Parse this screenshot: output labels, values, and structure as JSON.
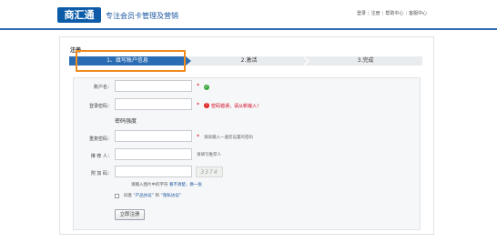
{
  "header": {
    "logo_text": "商汇通",
    "slogan": "专注会员卡管理及营销",
    "links": [
      "登录",
      "注册",
      "帮助中心",
      "客服中心"
    ]
  },
  "panel": {
    "title": "注册",
    "steps": [
      "1、填写账户信息",
      "2.激活",
      "3.完成"
    ]
  },
  "form": {
    "username": {
      "label": "账户名：",
      "value": ""
    },
    "password": {
      "label": "登录密码：",
      "value": "",
      "error": "密码错误，请从新输入！"
    },
    "strength_label": "密码强度",
    "confirm": {
      "label": "重复密码：",
      "value": "",
      "hint": "请再输入一遍您设置的密码"
    },
    "referrer": {
      "label": "推 荐 人：",
      "value": "",
      "hint": "请填写推荐人"
    },
    "captcha": {
      "label": "附 加 码：",
      "value": "",
      "image_text": "3374",
      "hint_prefix": "请输入图片中的字符",
      "refresh_link": "看不清楚，换一张"
    },
    "agree": {
      "prefix": "同意",
      "terms": "“产品协议”",
      "and": "和",
      "privacy": "“隐私协议”"
    },
    "submit_label": "立即注册"
  },
  "colors": {
    "brand_blue": "#2a6cb4",
    "highlight_orange": "#f08c1e",
    "error_red": "#d0021b",
    "ok_green": "#3aa63a"
  }
}
